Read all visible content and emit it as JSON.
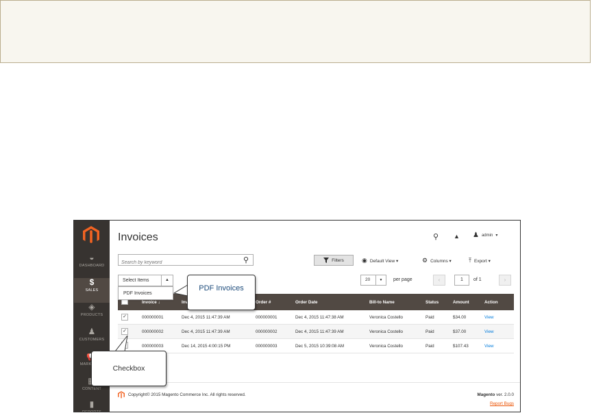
{
  "sidebar": {
    "items": [
      {
        "label": "DASHBOARD",
        "icon": "dashboard-icon",
        "glyph": "◒"
      },
      {
        "label": "SALES",
        "icon": "dollar-icon",
        "glyph": "$"
      },
      {
        "label": "PRODUCTS",
        "icon": "box-icon",
        "glyph": "◈"
      },
      {
        "label": "CUSTOMERS",
        "icon": "person-icon",
        "glyph": "♟"
      },
      {
        "label": "MARKETING",
        "icon": "megaphone-icon",
        "glyph": "📢"
      },
      {
        "label": "CONTENT",
        "icon": "layout-icon",
        "glyph": "▦"
      },
      {
        "label": "REPORTS",
        "icon": "bar-chart-icon",
        "glyph": "▮"
      }
    ]
  },
  "header": {
    "title": "Invoices",
    "user": "admin",
    "user_caret": "▾"
  },
  "toolbar": {
    "search_placeholder": "Search by keyword",
    "filters_label": "Filters",
    "view_label": "Default View ▾",
    "columns_label": "Columns ▾",
    "export_label": "Export ▾"
  },
  "mass_actions": {
    "select_label": "Select Items",
    "arrow": "▲",
    "options": [
      "PDF Invoices"
    ]
  },
  "pagination": {
    "per_page": "20",
    "per_page_label": "per page",
    "current_page": "1",
    "of_label": "of 1",
    "prev": "‹",
    "next": "›"
  },
  "grid": {
    "columns": [
      "Invoice ↓",
      "Invoice Date",
      "Order #",
      "Order Date",
      "Bill-to Name",
      "Status",
      "Amount",
      "Action"
    ],
    "rows": [
      {
        "invoice": "000000001",
        "invoice_date": "Dec 4, 2015 11:47:39 AM",
        "order": "000000001",
        "order_date": "Dec 4, 2015 11:47:38 AM",
        "bill_to": "Veronica Costello",
        "status": "Paid",
        "amount": "$34.00",
        "action": "View",
        "checked": true
      },
      {
        "invoice": "000000002",
        "invoice_date": "Dec 4, 2015 11:47:39 AM",
        "order": "000000002",
        "order_date": "Dec 4, 2015 11:47:39 AM",
        "bill_to": "Veronica Costello",
        "status": "Paid",
        "amount": "$37.00",
        "action": "View",
        "checked": true
      },
      {
        "invoice": "000000003",
        "invoice_date": "Dec 14, 2015 4:00:15 PM",
        "order": "000000003",
        "order_date": "Dec 5, 2015 10:39:08 AM",
        "bill_to": "Veronica Costello",
        "status": "Paid",
        "amount": "$107.43",
        "action": "View",
        "checked": false
      }
    ]
  },
  "footer": {
    "copyright": "Copyright© 2015 Magento Commerce Inc. All rights reserved.",
    "brand": "Magento",
    "version": "ver. 2.0.0",
    "report_bugs": "Report Bugs"
  },
  "callouts": {
    "pdf": "PDF Invoices",
    "checkbox": "Checkbox"
  },
  "colors": {
    "sidebar_bg": "#373330",
    "grid_header_bg": "#514943",
    "link": "#007bdb",
    "brand_orange": "#eb5202",
    "callout_text": "#1b4a7a"
  }
}
